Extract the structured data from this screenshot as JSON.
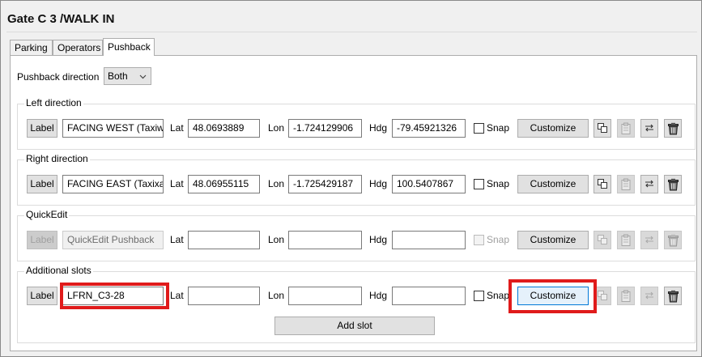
{
  "title": "Gate C 3 /WALK IN",
  "tabs": [
    {
      "label": "Parking"
    },
    {
      "label": "Operators"
    },
    {
      "label": "Pushback"
    }
  ],
  "pushback_direction": {
    "label": "Pushback direction",
    "value": "Both"
  },
  "field_labels": {
    "lat": "Lat",
    "lon": "Lon",
    "hdg": "Hdg",
    "snap": "Snap",
    "label_button": "Label",
    "customize": "Customize"
  },
  "groups": [
    {
      "title": "Left direction",
      "name": "FACING WEST (Taxiwa",
      "lat": "48.0693889",
      "lon": "-1.724129906",
      "hdg": "-79.45921326",
      "snap": false,
      "enabled": true
    },
    {
      "title": "Right direction",
      "name": "FACING EAST (Taxixay",
      "lat": "48.06955115",
      "lon": "-1.725429187",
      "hdg": "100.5407867",
      "snap": false,
      "enabled": true
    },
    {
      "title": "QuickEdit",
      "name": "QuickEdit Pushback",
      "lat": "",
      "lon": "",
      "hdg": "",
      "snap": false,
      "enabled": false
    },
    {
      "title": "Additional slots",
      "name": "LFRN_C3-28",
      "lat": "",
      "lon": "",
      "hdg": "",
      "snap": false,
      "enabled": true
    }
  ],
  "add_slot": "Add slot",
  "icons": [
    "duplicate-icon",
    "paste-icon",
    "swap-icon",
    "trash-icon"
  ],
  "colors": {
    "highlight": "#e01b1b",
    "focus": "#0078d7"
  }
}
